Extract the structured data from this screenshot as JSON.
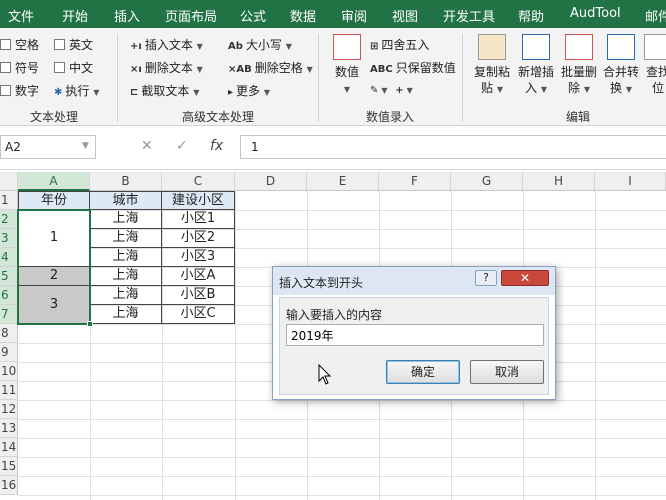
{
  "menubar": {
    "tabs": [
      "文件",
      "开始",
      "插入",
      "页面布局",
      "公式",
      "数据",
      "审阅",
      "视图",
      "开发工具",
      "帮助",
      "AudTool",
      "邮件"
    ]
  },
  "ribbon": {
    "text_group": {
      "checks": [
        "空格",
        "英文",
        "符号",
        "中文",
        "数字"
      ],
      "exec": "执行",
      "label": "文本处理"
    },
    "adv_group": {
      "items": [
        "插入文本",
        "删除文本",
        "截取文本",
        "大小写",
        "删除空格",
        "更多"
      ],
      "label": "高级文本处理"
    },
    "num_group": {
      "big": "数值",
      "items": [
        "四舍五入",
        "只保留数值"
      ],
      "label": "数值录入"
    },
    "edit_group": {
      "buttons": [
        {
          "line1": "复制粘",
          "line2": "贴"
        },
        {
          "line1": "新增插",
          "line2": "入"
        },
        {
          "line1": "批量删",
          "line2": "除"
        },
        {
          "line1": "合并转",
          "line2": "换"
        },
        {
          "line1": "查找",
          "line2": "位"
        }
      ],
      "label": "编辑"
    }
  },
  "formula_bar": {
    "name_box": "A2",
    "cancel_icon": "✕",
    "enter_icon": "✓",
    "fx": "fx",
    "value": "1"
  },
  "sheet": {
    "columns": [
      "A",
      "B",
      "C",
      "D",
      "E",
      "F",
      "G",
      "H",
      "I"
    ],
    "rows": [
      "1",
      "2",
      "3",
      "4",
      "5",
      "6",
      "7",
      "8",
      "9",
      "10",
      "11",
      "12",
      "13",
      "14",
      "15",
      "16"
    ],
    "header_row": [
      "年份",
      "城市",
      "建设小区"
    ],
    "years": [
      "1",
      "2",
      "3"
    ],
    "cities": [
      "上海",
      "上海",
      "上海",
      "上海",
      "上海",
      "上海"
    ],
    "districts": [
      "小区1",
      "小区2",
      "小区3",
      "小区A",
      "小区B",
      "小区C"
    ]
  },
  "dialog": {
    "title": "插入文本到开头",
    "help": "?",
    "close": "✕",
    "prompt": "输入要插入的内容",
    "input_value": "2019年",
    "ok": "确定",
    "cancel": "取消"
  },
  "colors": {
    "accent": "#217346",
    "selection": "#d3e7d9",
    "dialog_title": "#dde7f3"
  }
}
